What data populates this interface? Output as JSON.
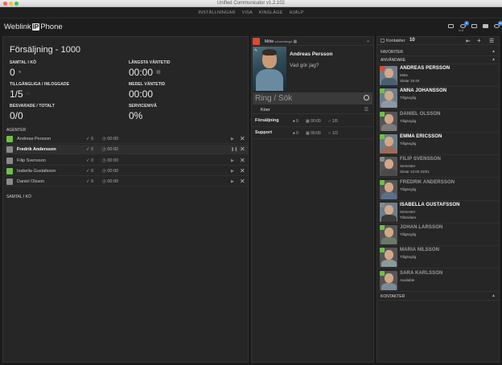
{
  "window": {
    "title": "Unified Communicator v1.2.102"
  },
  "menu": [
    "INSTÄLLNINGAR",
    "VISA",
    "KINGLÄGE",
    "HJÄLP"
  ],
  "logo": {
    "pre": "Weblink",
    "ip": "IP",
    "post": "Phone"
  },
  "header_icons": [
    {
      "name": "chat-icon",
      "badge": ""
    },
    {
      "name": "voicemail-icon",
      "badge": "8",
      "label": "null"
    },
    {
      "name": "call-log-icon",
      "badge": ""
    },
    {
      "name": "calendar-icon",
      "badge": ""
    },
    {
      "name": "history-icon",
      "badge": "40"
    }
  ],
  "queue": {
    "title": "Försäljning - 1000",
    "calls_in_queue_label": "SAMTAL I KÖ",
    "calls_in_queue": "0",
    "longest_wait_label": "LÄNGSTA VÄNTETID",
    "longest_wait": "00:00",
    "available_label": "TILLGÄNGLIGA / INLOGGADE",
    "available": "1/5",
    "avg_wait_label": "MEDEL VÄNTETID",
    "avg_wait": "00:00",
    "answered_label": "BESVARADE / TOTALT",
    "answered": "0/0",
    "service_label": "SERVICENIVÅ",
    "service": "0%"
  },
  "agents_label": "AGENTER",
  "agents": [
    {
      "name": "Andreas Persson",
      "count": "0",
      "time": "00:00",
      "color": "#6fbf4a",
      "active": false,
      "paused": false
    },
    {
      "name": "Fredrik Andersson",
      "count": "0",
      "time": "00:00",
      "color": "#8a8a8a",
      "active": true,
      "paused": true
    },
    {
      "name": "Filip Svensson",
      "count": "0",
      "time": "00:00",
      "color": "#8a8a8a",
      "active": false,
      "paused": false
    },
    {
      "name": "Isabella Gustafsson",
      "count": "0",
      "time": "00:00",
      "color": "#6fbf4a",
      "active": false,
      "paused": false
    },
    {
      "name": "Daniel  Olsson",
      "count": "0",
      "time": "00:00",
      "color": "#8a8a8a",
      "active": false,
      "paused": false
    }
  ],
  "calls_label": "SAMTAL I KÖ",
  "me": {
    "status": "Möte",
    "status_sub": "schemalagd",
    "name": "Andreas Persson",
    "prompt": "Vad gör jag?"
  },
  "search": {
    "placeholder": "Ring / Sök"
  },
  "queues_tab": "Köer",
  "queue_list": [
    {
      "name": "Försäljning",
      "a": "0",
      "b": "00:00",
      "c": "1/5"
    },
    {
      "name": "Support",
      "a": "0",
      "b": "00:00",
      "c": "1/3"
    }
  ],
  "contacts": {
    "label": "Kontakter",
    "count": "10",
    "favorites_label": "FAVORITER",
    "users_label": "ANVÄNDARE",
    "contacts_label": "KONTAKTER",
    "users": [
      {
        "name": "ANDREAS PERSSON",
        "sub1": "Möte",
        "sub2": "Slutar 15:40",
        "status": "#d84c33",
        "dim": false
      },
      {
        "name": "ANNA JOHANSSON",
        "sub1": "Tillgänglig",
        "sub2": "",
        "status": "#6fbf4a",
        "dim": false
      },
      {
        "name": "DANIEL  OLSSON",
        "sub1": "Tillgänglig",
        "sub2": "",
        "status": "#6fbf4a",
        "dim": true
      },
      {
        "name": "EMMA ERICSSON",
        "sub1": "Tillgänglig",
        "sub2": "",
        "status": "#6fbf4a",
        "dim": false
      },
      {
        "name": "FILIP SVENSSON",
        "sub1": "Semester",
        "sub2": "Slutar 12:00 23/01",
        "status": "#8a8a8a",
        "dim": true
      },
      {
        "name": "FREDRIK ANDERSSON",
        "sub1": "Tillgänglig",
        "sub2": "",
        "status": "#6fbf4a",
        "dim": true
      },
      {
        "name": "ISABELLA GUSTAFSSON",
        "sub1": "Semester",
        "sub2": "Tillsvidare",
        "status": "#8a8a8a",
        "dim": false
      },
      {
        "name": "JOHAN LARSSON",
        "sub1": "Tillgänglig",
        "sub2": "",
        "status": "#6fbf4a",
        "dim": true
      },
      {
        "name": "MARIA NILSSON",
        "sub1": "Tillgänglig",
        "sub2": "",
        "status": "#6fbf4a",
        "dim": true
      },
      {
        "name": "SARA  KARLSSON",
        "sub1": "Available",
        "sub2": "",
        "status": "#6fbf4a",
        "dim": true
      }
    ]
  }
}
